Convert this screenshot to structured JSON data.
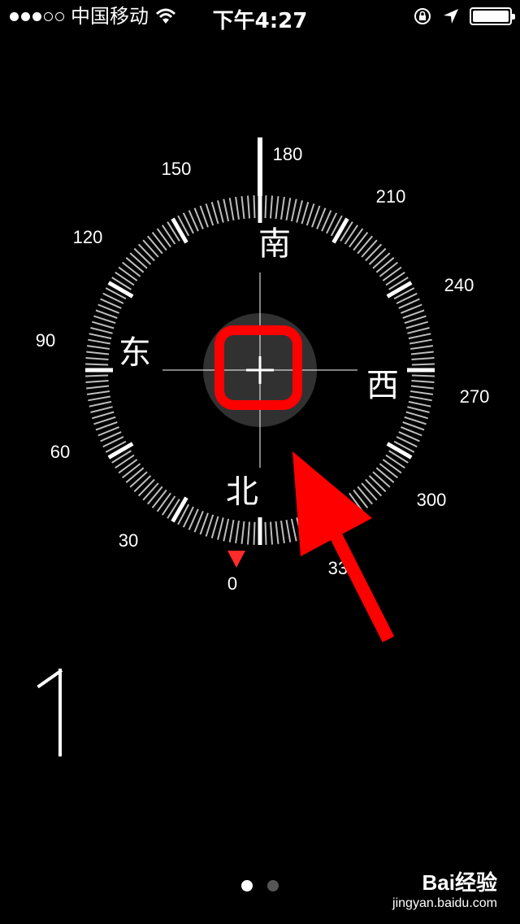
{
  "status_bar": {
    "carrier": "中国移动",
    "time": "下午4:27",
    "signal_bars_filled": 3,
    "signal_bars_total": 5
  },
  "compass": {
    "cardinals": {
      "south": "南",
      "west": "西",
      "north": "北",
      "east": "东"
    },
    "tick_labels": [
      "0",
      "30",
      "60",
      "90",
      "120",
      "150",
      "180",
      "210",
      "240",
      "270",
      "300",
      "330"
    ],
    "heading_value": "1",
    "annotation_color": "#ff0000"
  },
  "pager": {
    "total": 2,
    "active": 0
  },
  "watermark": {
    "brand": "Bai经验",
    "url": "jingyan.baidu.com"
  }
}
